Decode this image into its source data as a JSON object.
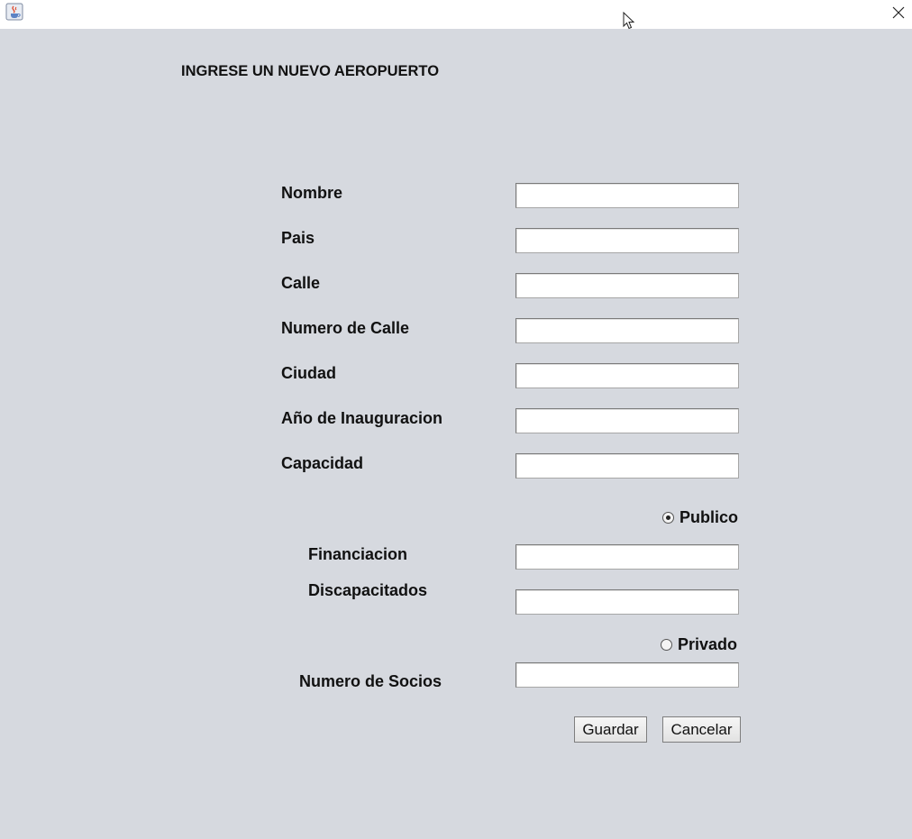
{
  "window": {
    "title": "",
    "icons": {
      "app": "java-cup-icon",
      "close": "close-icon",
      "cursor": "mouse-pointer-icon"
    }
  },
  "form": {
    "heading": "INGRESE UN NUEVO AEROPUERTO",
    "fields": {
      "nombre": {
        "label": "Nombre",
        "value": ""
      },
      "pais": {
        "label": "Pais",
        "value": ""
      },
      "calle": {
        "label": "Calle",
        "value": ""
      },
      "numero_calle": {
        "label": "Numero de Calle",
        "value": ""
      },
      "ciudad": {
        "label": "Ciudad",
        "value": ""
      },
      "anio_inauguracion": {
        "label": "Año de Inauguracion",
        "value": ""
      },
      "capacidad": {
        "label": "Capacidad",
        "value": ""
      },
      "financiacion": {
        "label": "Financiacion",
        "value": ""
      },
      "discapacitados": {
        "label": "Discapacitados",
        "value": ""
      },
      "numero_socios": {
        "label": "Numero de Socios",
        "value": ""
      }
    },
    "type_options": {
      "publico": {
        "label": "Publico",
        "selected": true
      },
      "privado": {
        "label": "Privado",
        "selected": false
      }
    },
    "buttons": {
      "save": "Guardar",
      "cancel": "Cancelar"
    }
  }
}
